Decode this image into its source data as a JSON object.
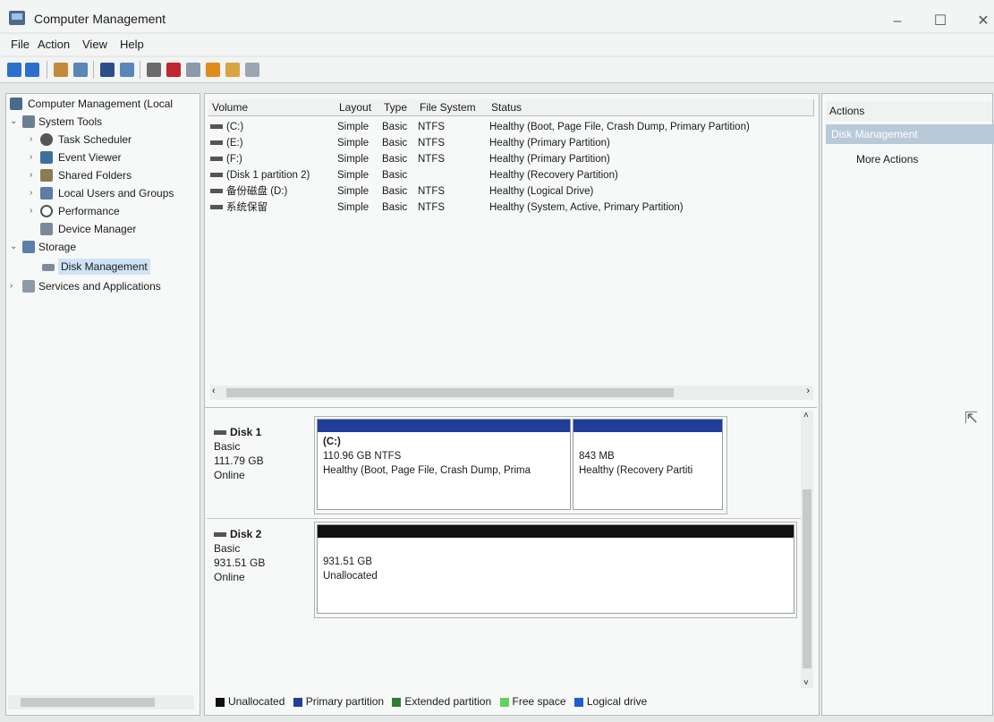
{
  "window": {
    "title": "Computer Management",
    "min": "–",
    "max": "☐",
    "close": "✕"
  },
  "menu": [
    "File",
    "Action",
    "View",
    "Help"
  ],
  "tree": {
    "root": "Computer Management (Local",
    "system_tools": "System Tools",
    "task_scheduler": "Task Scheduler",
    "event_viewer": "Event Viewer",
    "shared_folders": "Shared Folders",
    "local_users": "Local Users and Groups",
    "performance": "Performance",
    "device_manager": "Device Manager",
    "storage": "Storage",
    "disk_management": "Disk Management",
    "services": "Services and Applications"
  },
  "volume_table": {
    "headers": [
      "Volume",
      "Layout",
      "Type",
      "File System",
      "Status"
    ],
    "rows": [
      [
        "(C:)",
        "Simple",
        "Basic",
        "NTFS",
        "Healthy (Boot, Page File, Crash Dump, Primary Partition)"
      ],
      [
        "(E:)",
        "Simple",
        "Basic",
        "NTFS",
        "Healthy (Primary Partition)"
      ],
      [
        "(F:)",
        "Simple",
        "Basic",
        "NTFS",
        "Healthy (Primary Partition)"
      ],
      [
        "(Disk 1 partition 2)",
        "Simple",
        "Basic",
        "",
        "Healthy (Recovery Partition)"
      ],
      [
        "备份磁盘 (D:)",
        "Simple",
        "Basic",
        "NTFS",
        "Healthy (Logical Drive)"
      ],
      [
        "系统保留",
        "Simple",
        "Basic",
        "NTFS",
        "Healthy (System, Active, Primary Partition)"
      ]
    ]
  },
  "disks": [
    {
      "name": "Disk 1",
      "type": "Basic",
      "size": "111.79 GB",
      "state": "Online",
      "partitions": [
        {
          "line1": "(C:)",
          "line2": "110.96 GB NTFS",
          "line3": "Healthy (Boot, Page File, Crash Dump, Prima",
          "color": "#1f3d99"
        },
        {
          "line1": "",
          "line2": "843 MB",
          "line3": "Healthy (Recovery Partiti",
          "color": "#1f3d99"
        }
      ]
    },
    {
      "name": "Disk 2",
      "type": "Basic",
      "size": "931.51 GB",
      "state": "Online",
      "partitions": [
        {
          "line1": "",
          "line2": "931.51 GB",
          "line3": "Unallocated",
          "color": "#111111"
        }
      ]
    }
  ],
  "legend": [
    {
      "label": "Unallocated",
      "color": "#111111"
    },
    {
      "label": "Primary partition",
      "color": "#1f3d99"
    },
    {
      "label": "Extended partition",
      "color": "#2e7d32"
    },
    {
      "label": "Free space",
      "color": "#5fd35f"
    },
    {
      "label": "Logical drive",
      "color": "#1e5fd0"
    }
  ],
  "actions": {
    "header": "Actions",
    "selected": "Disk Management",
    "more": "More Actions"
  }
}
